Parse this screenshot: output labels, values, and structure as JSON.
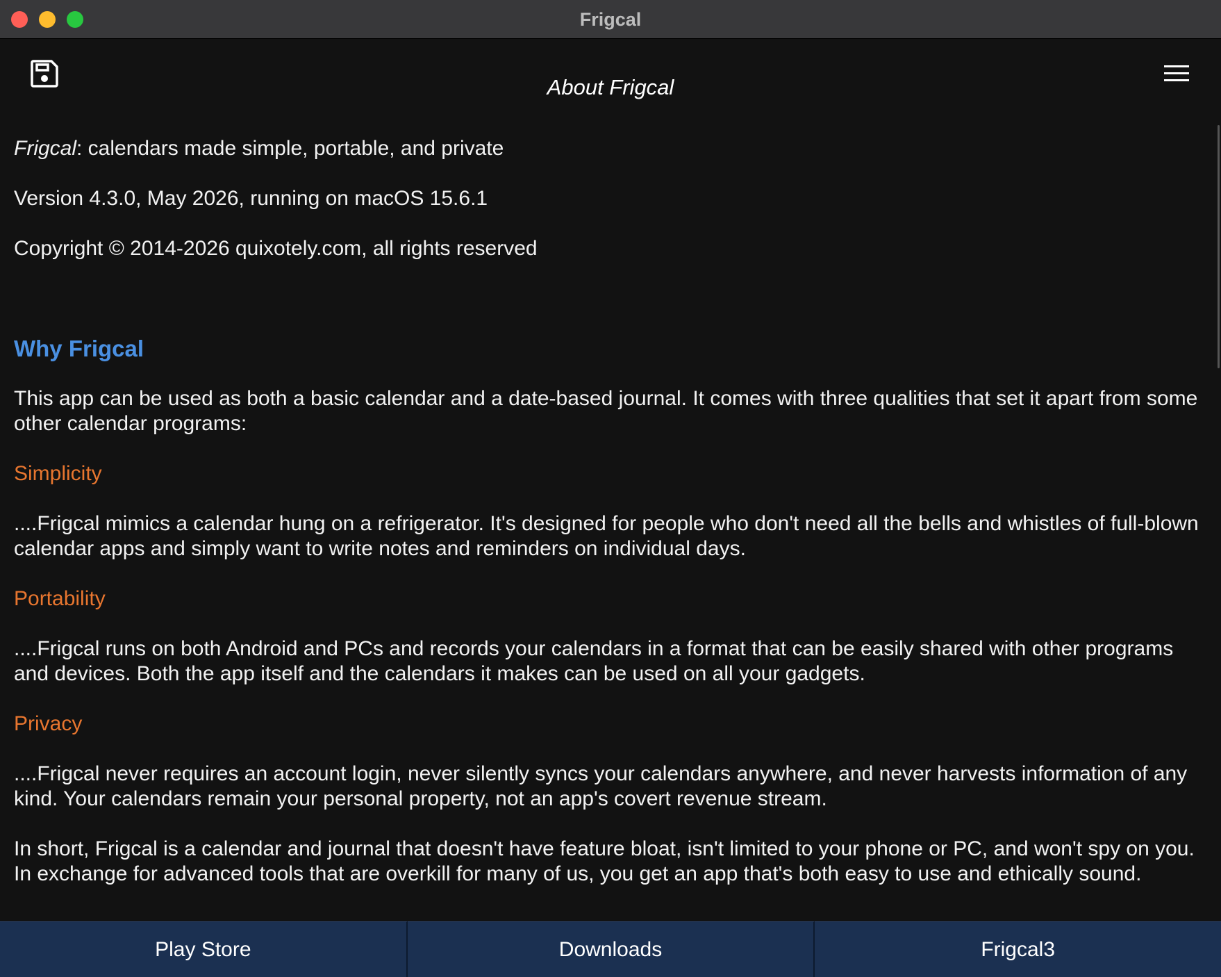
{
  "window": {
    "title": "Frigcal"
  },
  "toolbar": {
    "heading": "About Frigcal",
    "save_icon": "floppy-disk-save-icon",
    "menu_icon": "hamburger-menu-icon"
  },
  "about": {
    "tagline_app": "Frigcal",
    "tagline_rest": ": calendars made simple, portable, and private",
    "version": "Version 4.3.0, May 2026, running on macOS 15.6.1",
    "copyright": "Copyright © 2014-2026 quixotely.com, all rights reserved"
  },
  "why": {
    "title": "Why Frigcal",
    "intro": "This app can be used as both a basic calendar and a date-based journal.  It comes with three qualities that set it apart from some other calendar programs:",
    "qualities": [
      {
        "title": "Simplicity",
        "body": "....Frigcal mimics a calendar hung on a refrigerator.  It's designed for people who don't need all the bells and whistles of full-blown calendar apps and simply want to write notes and reminders on individual days."
      },
      {
        "title": "Portability",
        "body": "....Frigcal runs on both Android and PCs and records your calendars in a format that can be easily shared with other programs and devices.  Both the app itself and the calendars it makes can be used on all your gadgets."
      },
      {
        "title": "Privacy",
        "body": "....Frigcal never requires an account login, never silently syncs your calendars anywhere, and never harvests information of any kind.  Your calendars remain your personal property, not an app's covert revenue stream."
      }
    ],
    "summary": "In short, Frigcal is a calendar and journal that doesn't have feature bloat, isn't limited to your phone or PC, and won't spy on you.  In exchange for advanced tools that are overkill for many of us, you get an app that's both easy to use and ethically sound."
  },
  "bottom_bar": {
    "buttons": [
      "Play Store",
      "Downloads",
      "Frigcal3"
    ]
  },
  "colors": {
    "background": "#121212",
    "section_title": "#4a90e2",
    "quality_title": "#e8762f",
    "bottom_button": "#1b3051"
  }
}
